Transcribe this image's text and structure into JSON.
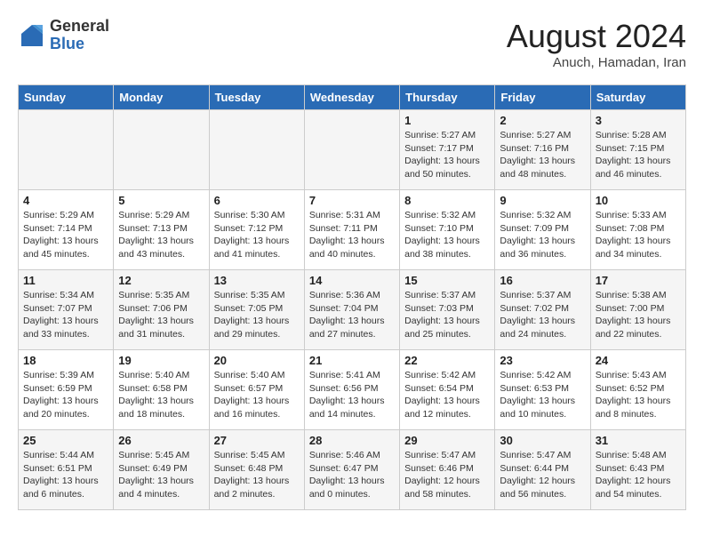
{
  "header": {
    "logo_general": "General",
    "logo_blue": "Blue",
    "month_year": "August 2024",
    "location": "Anuch, Hamadan, Iran"
  },
  "weekdays": [
    "Sunday",
    "Monday",
    "Tuesday",
    "Wednesday",
    "Thursday",
    "Friday",
    "Saturday"
  ],
  "weeks": [
    [
      {
        "day": "",
        "info": ""
      },
      {
        "day": "",
        "info": ""
      },
      {
        "day": "",
        "info": ""
      },
      {
        "day": "",
        "info": ""
      },
      {
        "day": "1",
        "info": "Sunrise: 5:27 AM\nSunset: 7:17 PM\nDaylight: 13 hours\nand 50 minutes."
      },
      {
        "day": "2",
        "info": "Sunrise: 5:27 AM\nSunset: 7:16 PM\nDaylight: 13 hours\nand 48 minutes."
      },
      {
        "day": "3",
        "info": "Sunrise: 5:28 AM\nSunset: 7:15 PM\nDaylight: 13 hours\nand 46 minutes."
      }
    ],
    [
      {
        "day": "4",
        "info": "Sunrise: 5:29 AM\nSunset: 7:14 PM\nDaylight: 13 hours\nand 45 minutes."
      },
      {
        "day": "5",
        "info": "Sunrise: 5:29 AM\nSunset: 7:13 PM\nDaylight: 13 hours\nand 43 minutes."
      },
      {
        "day": "6",
        "info": "Sunrise: 5:30 AM\nSunset: 7:12 PM\nDaylight: 13 hours\nand 41 minutes."
      },
      {
        "day": "7",
        "info": "Sunrise: 5:31 AM\nSunset: 7:11 PM\nDaylight: 13 hours\nand 40 minutes."
      },
      {
        "day": "8",
        "info": "Sunrise: 5:32 AM\nSunset: 7:10 PM\nDaylight: 13 hours\nand 38 minutes."
      },
      {
        "day": "9",
        "info": "Sunrise: 5:32 AM\nSunset: 7:09 PM\nDaylight: 13 hours\nand 36 minutes."
      },
      {
        "day": "10",
        "info": "Sunrise: 5:33 AM\nSunset: 7:08 PM\nDaylight: 13 hours\nand 34 minutes."
      }
    ],
    [
      {
        "day": "11",
        "info": "Sunrise: 5:34 AM\nSunset: 7:07 PM\nDaylight: 13 hours\nand 33 minutes."
      },
      {
        "day": "12",
        "info": "Sunrise: 5:35 AM\nSunset: 7:06 PM\nDaylight: 13 hours\nand 31 minutes."
      },
      {
        "day": "13",
        "info": "Sunrise: 5:35 AM\nSunset: 7:05 PM\nDaylight: 13 hours\nand 29 minutes."
      },
      {
        "day": "14",
        "info": "Sunrise: 5:36 AM\nSunset: 7:04 PM\nDaylight: 13 hours\nand 27 minutes."
      },
      {
        "day": "15",
        "info": "Sunrise: 5:37 AM\nSunset: 7:03 PM\nDaylight: 13 hours\nand 25 minutes."
      },
      {
        "day": "16",
        "info": "Sunrise: 5:37 AM\nSunset: 7:02 PM\nDaylight: 13 hours\nand 24 minutes."
      },
      {
        "day": "17",
        "info": "Sunrise: 5:38 AM\nSunset: 7:00 PM\nDaylight: 13 hours\nand 22 minutes."
      }
    ],
    [
      {
        "day": "18",
        "info": "Sunrise: 5:39 AM\nSunset: 6:59 PM\nDaylight: 13 hours\nand 20 minutes."
      },
      {
        "day": "19",
        "info": "Sunrise: 5:40 AM\nSunset: 6:58 PM\nDaylight: 13 hours\nand 18 minutes."
      },
      {
        "day": "20",
        "info": "Sunrise: 5:40 AM\nSunset: 6:57 PM\nDaylight: 13 hours\nand 16 minutes."
      },
      {
        "day": "21",
        "info": "Sunrise: 5:41 AM\nSunset: 6:56 PM\nDaylight: 13 hours\nand 14 minutes."
      },
      {
        "day": "22",
        "info": "Sunrise: 5:42 AM\nSunset: 6:54 PM\nDaylight: 13 hours\nand 12 minutes."
      },
      {
        "day": "23",
        "info": "Sunrise: 5:42 AM\nSunset: 6:53 PM\nDaylight: 13 hours\nand 10 minutes."
      },
      {
        "day": "24",
        "info": "Sunrise: 5:43 AM\nSunset: 6:52 PM\nDaylight: 13 hours\nand 8 minutes."
      }
    ],
    [
      {
        "day": "25",
        "info": "Sunrise: 5:44 AM\nSunset: 6:51 PM\nDaylight: 13 hours\nand 6 minutes."
      },
      {
        "day": "26",
        "info": "Sunrise: 5:45 AM\nSunset: 6:49 PM\nDaylight: 13 hours\nand 4 minutes."
      },
      {
        "day": "27",
        "info": "Sunrise: 5:45 AM\nSunset: 6:48 PM\nDaylight: 13 hours\nand 2 minutes."
      },
      {
        "day": "28",
        "info": "Sunrise: 5:46 AM\nSunset: 6:47 PM\nDaylight: 13 hours\nand 0 minutes."
      },
      {
        "day": "29",
        "info": "Sunrise: 5:47 AM\nSunset: 6:46 PM\nDaylight: 12 hours\nand 58 minutes."
      },
      {
        "day": "30",
        "info": "Sunrise: 5:47 AM\nSunset: 6:44 PM\nDaylight: 12 hours\nand 56 minutes."
      },
      {
        "day": "31",
        "info": "Sunrise: 5:48 AM\nSunset: 6:43 PM\nDaylight: 12 hours\nand 54 minutes."
      }
    ]
  ]
}
